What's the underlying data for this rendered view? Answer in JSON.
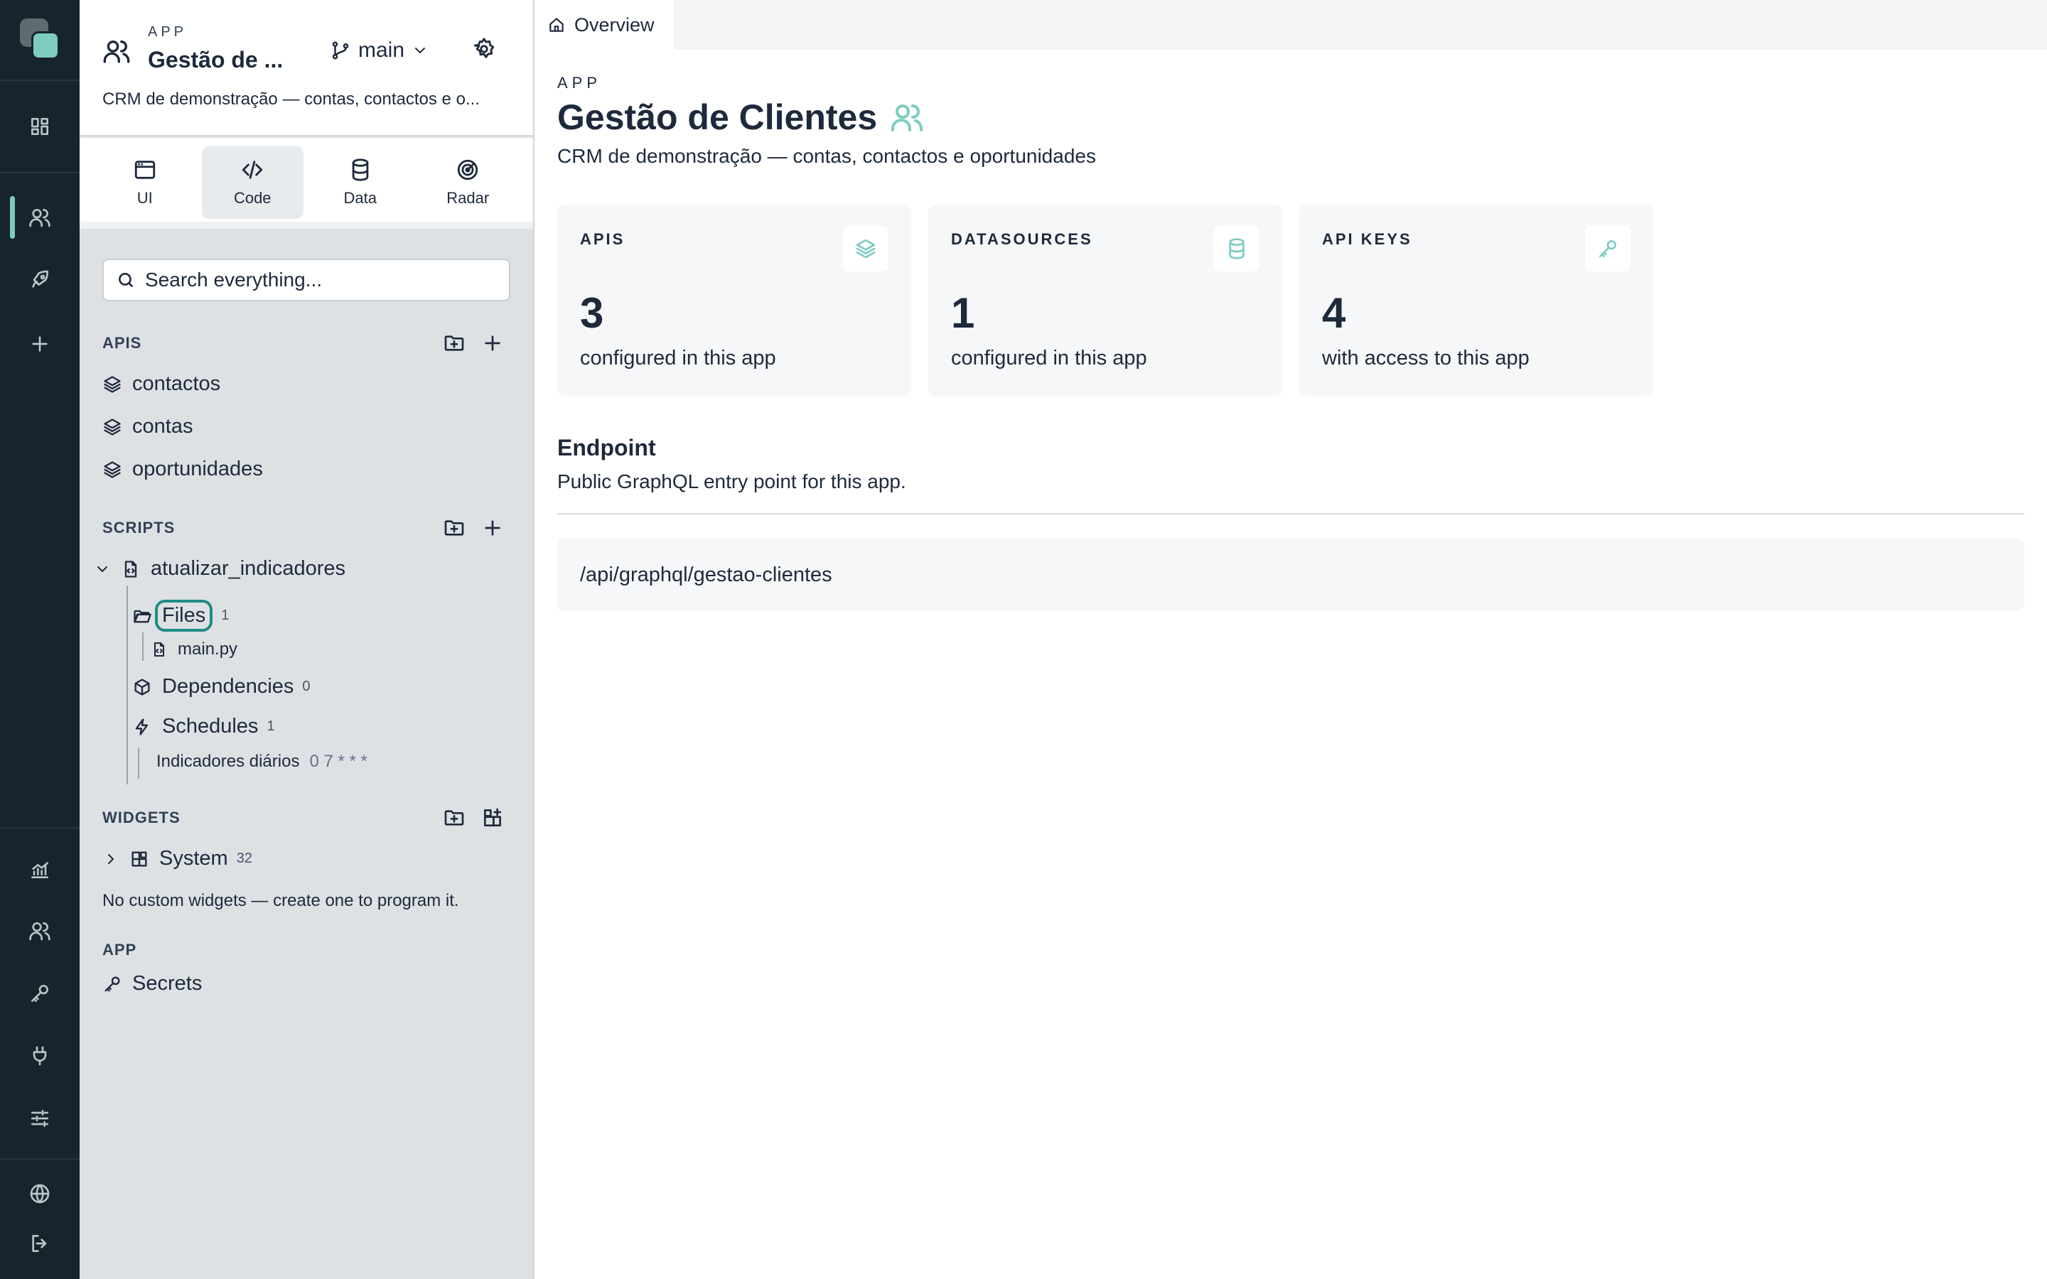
{
  "sidebar": {
    "kicker": "APP",
    "app_name": "Gestão de ...",
    "branch": "main",
    "description": "CRM de demonstração — contas, contactos e o...",
    "tabs": [
      {
        "label": "UI"
      },
      {
        "label": "Code"
      },
      {
        "label": "Data"
      },
      {
        "label": "Radar"
      }
    ],
    "search_placeholder": "Search everything...",
    "apis": {
      "title": "APIS",
      "items": [
        "contactos",
        "contas",
        "oportunidades"
      ]
    },
    "scripts": {
      "title": "SCRIPTS",
      "script_name": "atualizar_indicadores",
      "files_label": "Files",
      "files_count": "1",
      "file_name": "main.py",
      "dependencies_label": "Dependencies",
      "dependencies_count": "0",
      "schedules_label": "Schedules",
      "schedules_count": "1",
      "schedule_name": "Indicadores diários",
      "schedule_cron": "0 7 * * *"
    },
    "widgets": {
      "title": "WIDGETS",
      "system_label": "System",
      "system_count": "32",
      "note": "No custom widgets — create one to program it."
    },
    "app_section": {
      "title": "APP",
      "secrets_label": "Secrets"
    }
  },
  "main": {
    "tab_label": "Overview",
    "kicker": "APP",
    "title": "Gestão de Clientes",
    "description": "CRM de demonstração — contas, contactos e oportunidades",
    "cards": [
      {
        "label": "APIS",
        "value": "3",
        "sub": "configured in this app"
      },
      {
        "label": "DATASOURCES",
        "value": "1",
        "sub": "configured in this app"
      },
      {
        "label": "API KEYS",
        "value": "4",
        "sub": "with access to this app"
      }
    ],
    "endpoint": {
      "title": "Endpoint",
      "description": "Public GraphQL entry point for this app.",
      "path": "/api/graphql/gestao-clientes"
    }
  },
  "colors": {
    "rail_bg": "#16242c",
    "accent": "#7ccdc0",
    "highlight": "#1f8d83",
    "sidebar_bg": "#dde1e4"
  }
}
